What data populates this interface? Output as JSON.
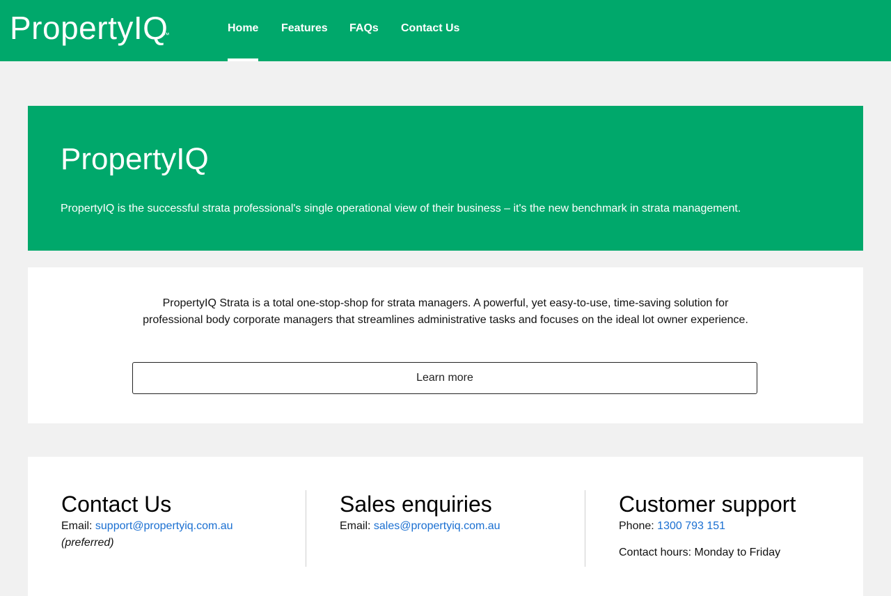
{
  "brand": {
    "logo_text": "PropertyIQ",
    "logo_tm": "™",
    "primary_color": "#00a86b",
    "link_color": "#1a6fd1"
  },
  "nav": {
    "items": [
      {
        "label": "Home",
        "active": true
      },
      {
        "label": "Features",
        "active": false
      },
      {
        "label": "FAQs",
        "active": false
      },
      {
        "label": "Contact Us",
        "active": false
      }
    ]
  },
  "hero": {
    "title": "PropertyIQ",
    "text": "PropertyIQ is the successful strata professional's single operational view of their business – it's the new benchmark in strata management."
  },
  "intro": {
    "text": "PropertyIQ Strata is a total one-stop-shop for strata managers. A powerful, yet easy-to-use, time-saving solution for professional body corporate managers that streamlines administrative tasks and focuses on the ideal lot owner experience.",
    "button_label": "Learn more"
  },
  "contact": {
    "contact_us": {
      "heading": "Contact Us",
      "email_label": "Email:",
      "email": "support@propertyiq.com.au",
      "note": "(preferred)"
    },
    "sales": {
      "heading": "Sales enquiries",
      "email_label": "Email:",
      "email": "sales@propertyiq.com.au"
    },
    "support": {
      "heading": "Customer support",
      "phone_label": "Phone:",
      "phone": "1300 793 151",
      "hours_partial": "Contact hours: Monday to Friday"
    }
  }
}
